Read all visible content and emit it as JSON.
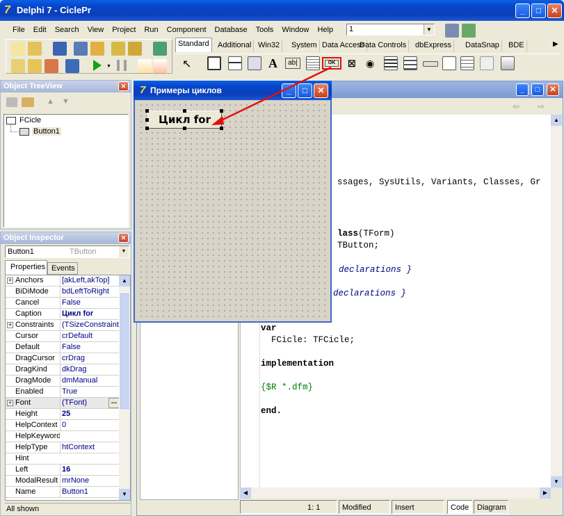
{
  "app": {
    "title": "Delphi 7 - CiclePr"
  },
  "menu": [
    "File",
    "Edit",
    "Search",
    "View",
    "Project",
    "Run",
    "Component",
    "Database",
    "Tools",
    "Window",
    "Help"
  ],
  "desktop_combo": "1",
  "palette_tabs": [
    "Standard",
    "Additional",
    "Win32",
    "System",
    "Data Access",
    "Data Controls",
    "dbExpress",
    "DataSnap",
    "BDE"
  ],
  "tree_view": {
    "title": "Object TreeView",
    "root": "FCicle",
    "child": "Button1"
  },
  "inspector": {
    "title": "Object Inspector",
    "selected_name": "Button1",
    "selected_type": "TButton",
    "tab_properties": "Properties",
    "tab_events": "Events",
    "rows": [
      {
        "k": "Anchors",
        "v": "[akLeft,akTop]",
        "plus": true
      },
      {
        "k": "BiDiMode",
        "v": "bdLeftToRight"
      },
      {
        "k": "Cancel",
        "v": "False"
      },
      {
        "k": "Caption",
        "v": "Цикл for",
        "bold": true
      },
      {
        "k": "Constraints",
        "v": "(TSizeConstraints)",
        "plus": true
      },
      {
        "k": "Cursor",
        "v": "crDefault"
      },
      {
        "k": "Default",
        "v": "False"
      },
      {
        "k": "DragCursor",
        "v": "crDrag"
      },
      {
        "k": "DragKind",
        "v": "dkDrag"
      },
      {
        "k": "DragMode",
        "v": "dmManual"
      },
      {
        "k": "Enabled",
        "v": "True"
      },
      {
        "k": "Font",
        "v": "(TFont)",
        "plus": true
      },
      {
        "k": "Height",
        "v": "25",
        "bold": true
      },
      {
        "k": "HelpContext",
        "v": "0"
      },
      {
        "k": "HelpKeyword",
        "v": ""
      },
      {
        "k": "HelpType",
        "v": "htContext"
      },
      {
        "k": "Hint",
        "v": ""
      },
      {
        "k": "Left",
        "v": "16",
        "bold": true
      },
      {
        "k": "ModalResult",
        "v": "mrNone"
      },
      {
        "k": "Name",
        "v": "Button1"
      }
    ],
    "footer": "All shown",
    "font_ellipsis": "..."
  },
  "form": {
    "title": "Примеры циклов",
    "button_caption": "Цикл for",
    "ok_component": "OK"
  },
  "code": {
    "lines": [
      {
        "t": "ssages, SysUtils, Variants, Classes, Gr"
      },
      {
        "t": "lass(TForm)",
        "kw": "lass"
      },
      {
        "t": "TButton;"
      },
      {
        "t": "declarations }",
        "style": "i"
      },
      {
        "t": "declarations }",
        "style": "i"
      },
      {
        "t": "var",
        "style": "b"
      },
      {
        "t": "  FCicle: TFCicle;"
      },
      {
        "t": "implementation",
        "style": "b"
      },
      {
        "t": "{$R *.dfm}",
        "style": "g"
      },
      {
        "t": "end.",
        "style": "b"
      }
    ]
  },
  "status": {
    "pos": "1:   1",
    "modified": "Modified",
    "mode": "Insert",
    "tab_code": "Code",
    "tab_diagram": "Diagram"
  },
  "colors": {
    "titlebar": "#0a46c8",
    "highlight_red": "#e01010",
    "form_bg": "#d8d4c8"
  }
}
